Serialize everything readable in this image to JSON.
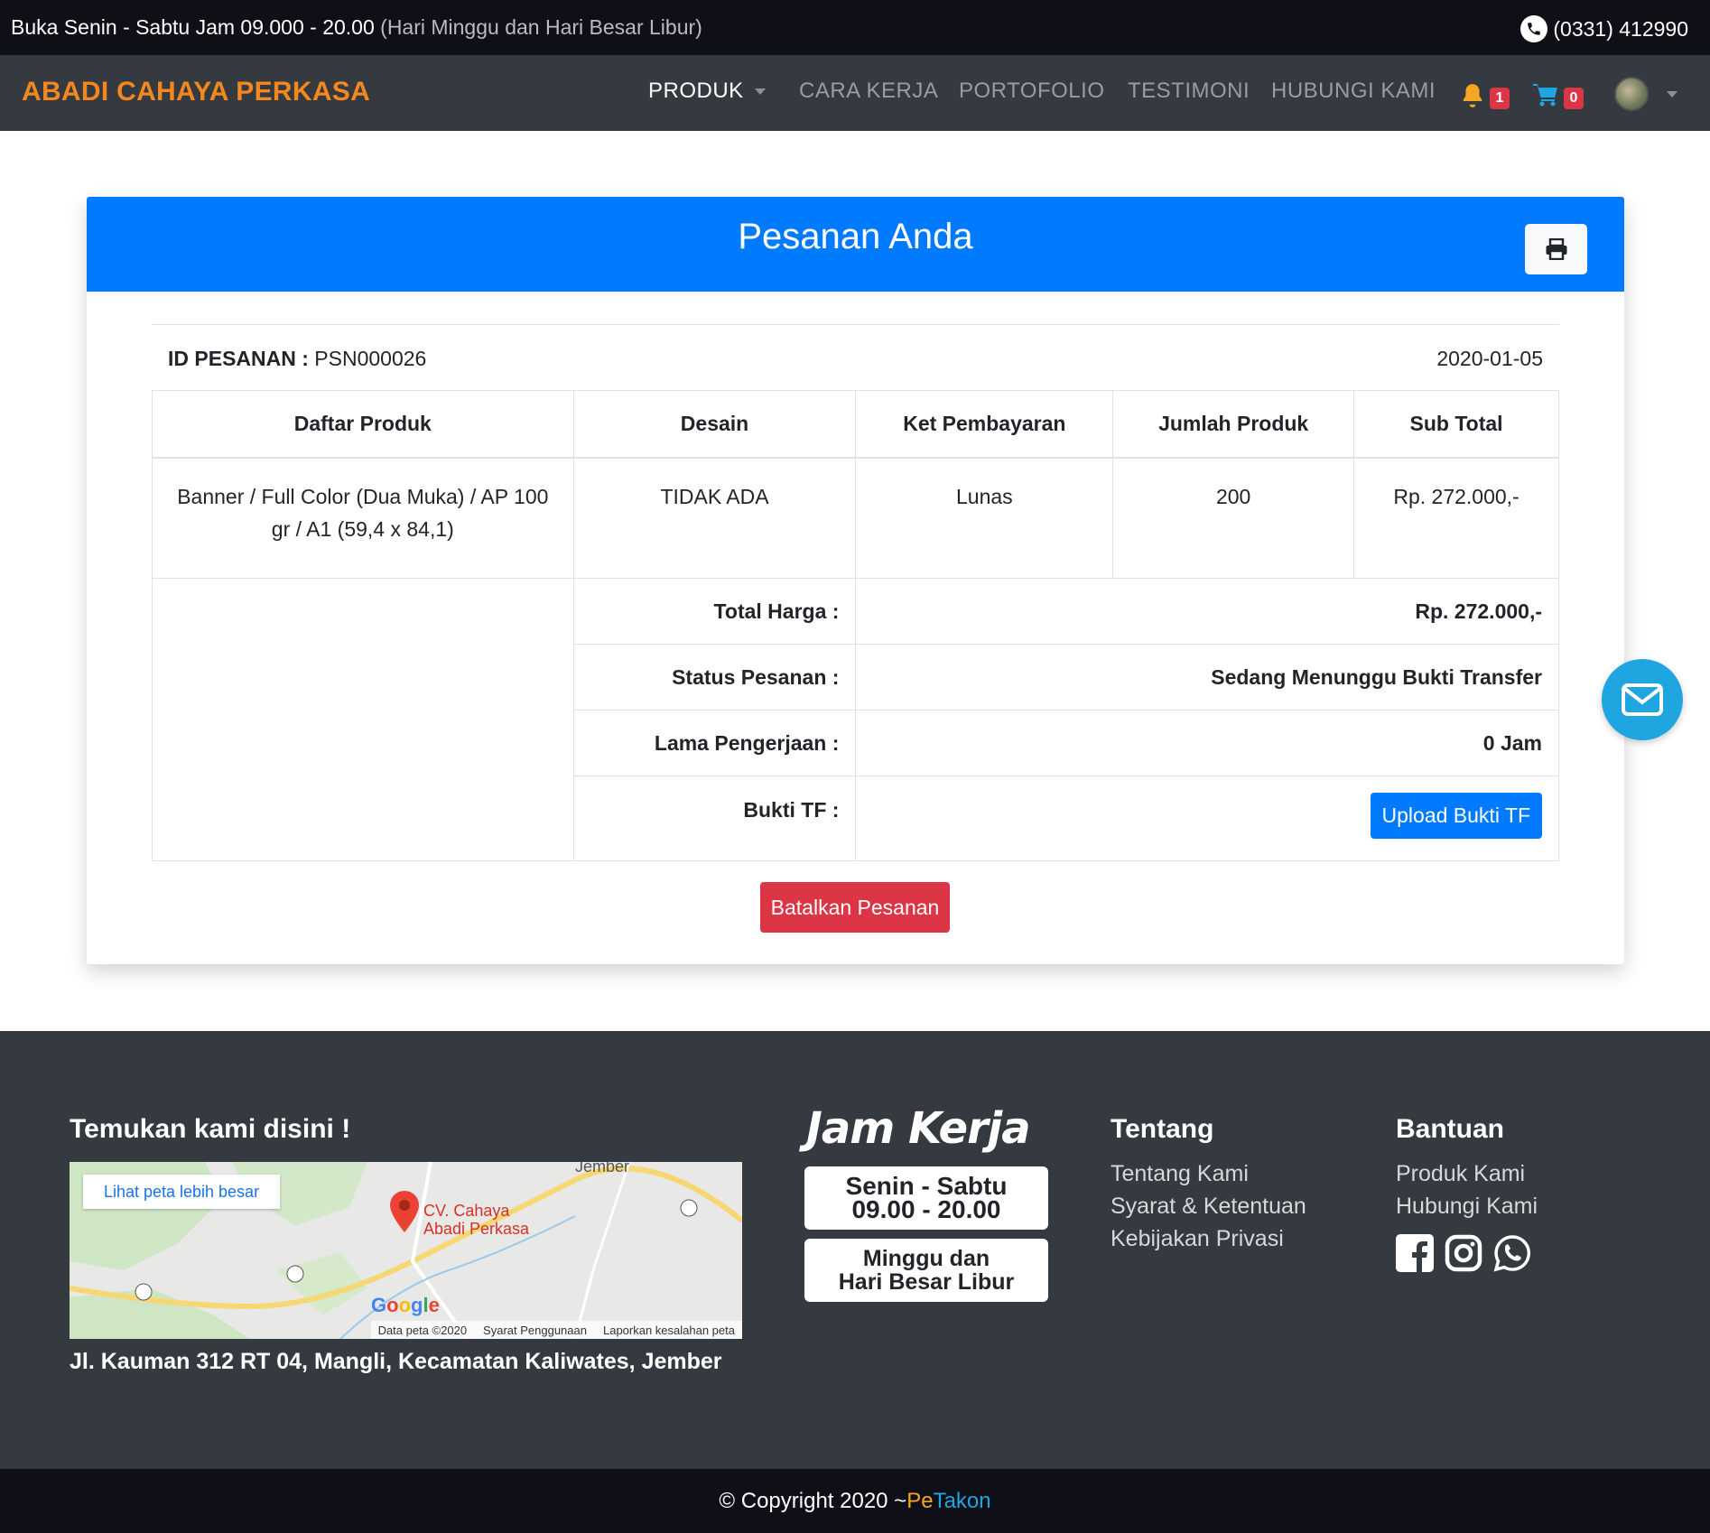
{
  "topbar": {
    "hours_main": "Buka Senin - Sabtu Jam 09.000 - 20.00",
    "hours_note": "(Hari Minggu dan Hari Besar Libur)",
    "phone": "(0331) 412990"
  },
  "navbar": {
    "brand": "ABADI CAHAYA PERKASA",
    "items": [
      "PRODUK",
      "CARA KERJA",
      "PORTOFOLIO",
      "TESTIMONI",
      "HUBUNGI KAMI"
    ],
    "notification_count": "1",
    "cart_count": "0"
  },
  "order": {
    "title": "Pesanan Anda",
    "id_label": "ID PESANAN :",
    "id_value": "PSN000026",
    "date": "2020-01-05",
    "columns": [
      "Daftar Produk",
      "Desain",
      "Ket Pembayaran",
      "Jumlah Produk",
      "Sub Total"
    ],
    "row": {
      "product": "Banner / Full Color (Dua Muka) / AP 100 gr / A1 (59,4 x 84,1)",
      "design": "TIDAK ADA",
      "payment": "Lunas",
      "quantity": "200",
      "subtotal": "Rp. 272.000,-"
    },
    "summary": {
      "total_label": "Total Harga :",
      "total_value": "Rp. 272.000,-",
      "status_label": "Status Pesanan :",
      "status_value": "Sedang Menunggu Bukti Transfer",
      "duration_label": "Lama Pengerjaan :",
      "duration_value": "0 Jam",
      "proof_label": "Bukti TF :"
    },
    "upload_button": "Upload Bukti TF",
    "cancel_button": "Batalkan Pesanan"
  },
  "footer": {
    "find_us": "Temukan kami disini !",
    "map": {
      "larger_map": "Lihat peta lebih besar",
      "place_line1": "CV. Cahaya",
      "place_line2": "Abadi Perkasa",
      "city": "Jember",
      "google": "Google",
      "data": "Data peta ©2020",
      "terms": "Syarat Penggunaan",
      "report": "Laporkan kesalahan peta"
    },
    "address": "Jl. Kauman 312 RT 04, Mangli, Kecamatan Kaliwates, Jember",
    "jam_title": "Jam Kerja",
    "jam_days": "Senin - Sabtu",
    "jam_time": "09.00 - 20.00",
    "jam_off1": "Minggu dan",
    "jam_off2": "Hari Besar Libur",
    "about_title": "Tentang",
    "about_links": [
      "Tentang Kami",
      "Syarat & Ketentuan",
      "Kebijakan Privasi"
    ],
    "help_title": "Bantuan",
    "help_links": [
      "Produk Kami",
      "Hubungi Kami"
    ],
    "social_icons": [
      "facebook-icon",
      "instagram-icon",
      "whatsapp-icon"
    ]
  },
  "copyright": {
    "text": "© Copyright 2020 ~ ",
    "brand_pe": "Pe",
    "brand_takon": "Takon"
  },
  "colors": {
    "primary": "#007bff",
    "danger": "#dc3545",
    "brand_orange": "#f5871f",
    "nav_bg": "#343a40",
    "bar_bg": "#0f0f17",
    "mail_fab": "#1fa6e0"
  }
}
